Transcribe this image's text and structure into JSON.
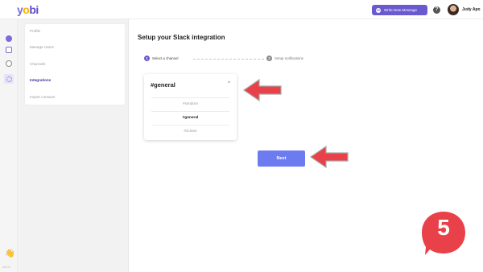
{
  "app": {
    "logo_text": "yobi",
    "write_button_label": "Write New Message",
    "help_label": "?",
    "user_name": "Judy Apo",
    "version": "v2.1.0"
  },
  "settings_nav": {
    "items": [
      {
        "label": "Profile"
      },
      {
        "label": "Manage Users"
      },
      {
        "label": "Channels"
      },
      {
        "label": "Integrations",
        "active": true
      },
      {
        "label": "Import contacts"
      }
    ]
  },
  "main": {
    "title": "Setup your Slack integration",
    "steps": [
      {
        "num": "1",
        "label": "Select a channel",
        "state": "active"
      },
      {
        "num": "2",
        "label": "Setup notifications",
        "state": "inactive"
      }
    ],
    "dropdown": {
      "selected": "#general",
      "options": [
        "#random",
        "#general",
        "#sclose"
      ]
    },
    "next_label": "Next"
  },
  "annotation": {
    "step_badge": "5",
    "arrow_color": "#e8414a",
    "badge_color": "#e8414a"
  },
  "colors": {
    "accent": "#6a5ad0",
    "button": "#6c7cf0"
  }
}
